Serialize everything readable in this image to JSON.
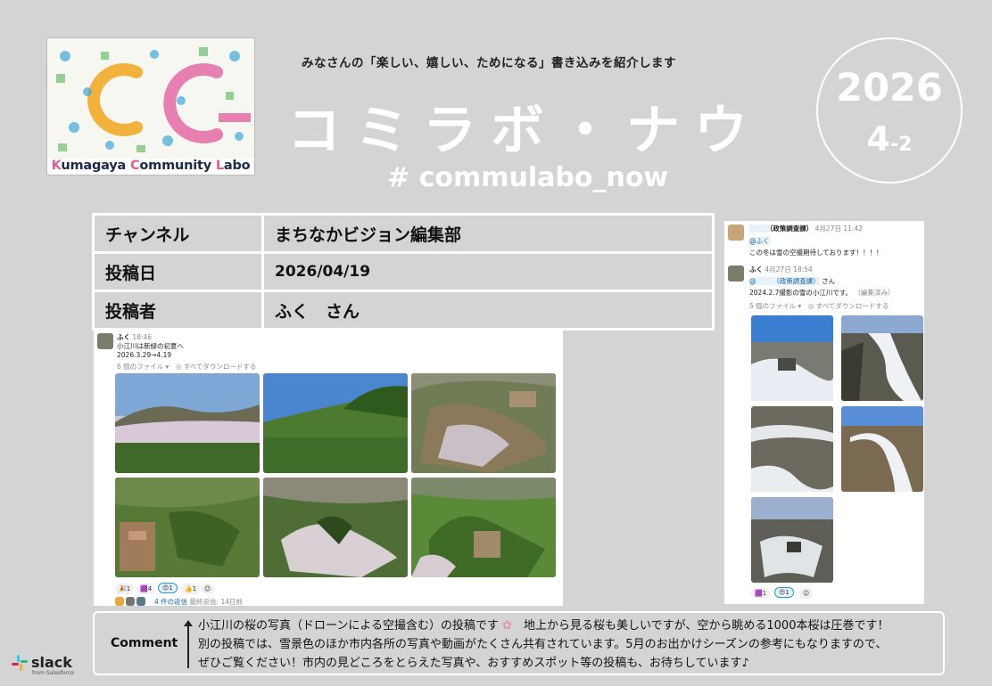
{
  "logo": {
    "k": "K",
    "umagaya": "umagaya ",
    "c": "C",
    "ommunity": "ommunity ",
    "l": "L",
    "abo": "abo"
  },
  "header": {
    "tagline": "みなさんの「楽しい、嬉しい、ためになる」書き込みを紹介します",
    "title": "コミラボ・ナウ",
    "hashtag": "# commulabo_now"
  },
  "date_badge": {
    "year": "2026",
    "month": "4",
    "issue": "-2"
  },
  "info": {
    "channel_label": "チャンネル",
    "channel_value": "まちなかビジョン編集部",
    "date_label": "投稿日",
    "date_value": "2026/04/19",
    "poster_label": "投稿者",
    "poster_value": "ふく　さん"
  },
  "main_post": {
    "author": "ふく",
    "time": "18:46",
    "line1": "小江川は新緑の初夏へ",
    "line2": "2026.3.29→4.19",
    "files": "6 個のファイル ▾",
    "download": "すべてダウンロードする",
    "reactions": [
      "1",
      "4",
      "1",
      "1"
    ],
    "thread_count": "4 件の返信",
    "thread_last": "最終返信: 14日前"
  },
  "side_post": {
    "author1": "（政策調査課）",
    "time1": "4月27日 11:42",
    "mention1": "@ふく",
    "msg1": "この冬は雪の空撮期待しております！！！！",
    "author2": "ふく",
    "time2": "4月27日 18:54",
    "mention2": "@　　　（政策調査課）",
    "mention2_suffix": "さん",
    "msg2": "2024.2.7撮影の雪の小江川です。",
    "edited": "（編集済み）",
    "files": "5 個のファイル ▾",
    "download": "すべてダウンロードする",
    "reactions": [
      "1",
      "1"
    ]
  },
  "comment": {
    "label": "Comment",
    "line1a": "小江川の桜の写真（ドローンによる空撮含む）の投稿です",
    "line1b": "地上から見る桜も美しいですが、空から眺める1000本桜は圧巻です！",
    "line2": "別の投稿では、雪景色のほか市内各所の写真や動画がたくさん共有されています。5月のお出かけシーズンの参考にもなりますので、",
    "line3": "ぜひご覧ください！市内の見どころをとらえた写真や、おすすめスポット等の投稿も、お待ちしています♪"
  },
  "footer": {
    "brand": "slack",
    "sub": "from Salesforce"
  }
}
